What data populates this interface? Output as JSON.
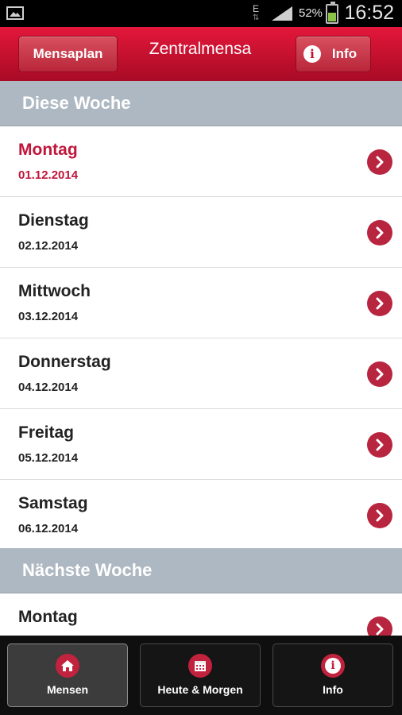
{
  "status_bar": {
    "network": "E",
    "battery_percent": "52%",
    "battery_level": 0.52,
    "time": "16:52"
  },
  "header": {
    "left_button": "Mensaplan",
    "title": "Zentralmensa",
    "right_button": "Info",
    "right_button_icon": "info-icon"
  },
  "sections": [
    {
      "title": "Diese Woche",
      "days": [
        {
          "day": "Montag",
          "date": "01.12.2014",
          "active": true
        },
        {
          "day": "Dienstag",
          "date": "02.12.2014"
        },
        {
          "day": "Mittwoch",
          "date": "03.12.2014"
        },
        {
          "day": "Donnerstag",
          "date": "04.12.2014"
        },
        {
          "day": "Freitag",
          "date": "05.12.2014"
        },
        {
          "day": "Samstag",
          "date": "06.12.2014"
        }
      ]
    },
    {
      "title": "Nächste Woche",
      "days": [
        {
          "day": "Montag",
          "date": ""
        }
      ]
    }
  ],
  "tabs": [
    {
      "label": "Mensen",
      "icon": "home-icon",
      "selected": true
    },
    {
      "label": "Heute & Morgen",
      "icon": "calendar-icon"
    },
    {
      "label": "Info",
      "icon": "info-icon"
    }
  ],
  "colors": {
    "accent": "#c0102d",
    "active_text": "#c0163a",
    "section_bg": "#aeb8c2",
    "chevron": "#b8253f"
  }
}
